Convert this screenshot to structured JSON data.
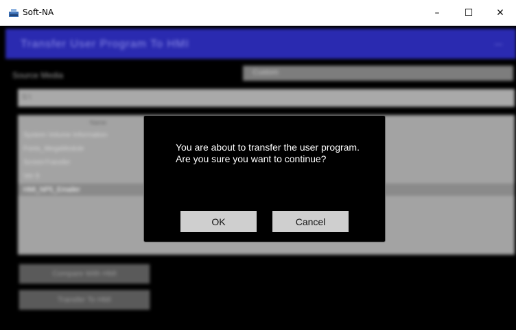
{
  "window": {
    "title": "Soft-NA",
    "minimize_glyph": "–",
    "maximize_glyph": "☐",
    "close_glyph": "✕"
  },
  "background": {
    "header_title": "Transfer User Program To HMI",
    "header_right": "—",
    "source_media_label": "Source Media",
    "source_media_value": "Custom",
    "path_value": "S:\\",
    "list_header": "Name",
    "files": [
      "System Volume Information",
      "Fonts_MegaModule",
      "ScreenTransfer",
      "Ver 8",
      "HMI_NP5_Emailer"
    ],
    "compare_button": "Compare With HMI",
    "transfer_button": "Transfer To HMI"
  },
  "dialog": {
    "message": "You are about to transfer the user program. Are you sure you want to continue?",
    "ok_label": "OK",
    "cancel_label": "Cancel"
  },
  "colors": {
    "header_accent": "#2a2ab0",
    "dialog_background": "#000000",
    "dialog_button": "#cfcfcf"
  }
}
